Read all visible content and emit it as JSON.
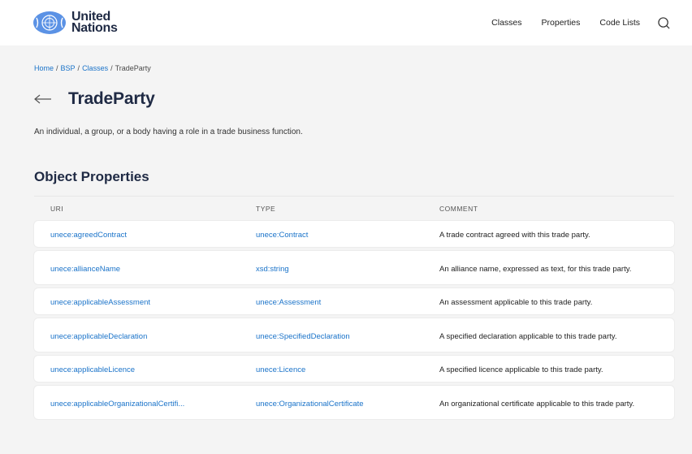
{
  "header": {
    "logo_line1": "United",
    "logo_line2": "Nations",
    "nav": [
      "Classes",
      "Properties",
      "Code Lists"
    ],
    "search_icon": "search-icon"
  },
  "breadcrumb": {
    "items": [
      "Home",
      "BSP",
      "Classes"
    ],
    "current": "TradeParty",
    "separator": "/"
  },
  "page": {
    "title": "TradeParty",
    "description": "An individual, a group, or a body having a role in a trade business function."
  },
  "object_properties": {
    "title": "Object Properties",
    "columns": [
      "URI",
      "TYPE",
      "COMMENT"
    ],
    "rows": [
      {
        "uri": "unece:agreedContract",
        "type": "unece:Contract",
        "comment": "A trade contract agreed with this trade party."
      },
      {
        "uri": "unece:allianceName",
        "type": "xsd:string",
        "comment": "An alliance name, expressed as text, for this trade party."
      },
      {
        "uri": "unece:applicableAssessment",
        "type": "unece:Assessment",
        "comment": "An assessment applicable to this trade party."
      },
      {
        "uri": "unece:applicableDeclaration",
        "type": "unece:SpecifiedDeclaration",
        "comment": "A specified declaration applicable to this trade party."
      },
      {
        "uri": "unece:applicableLicence",
        "type": "unece:Licence",
        "comment": "A specified licence applicable to this trade party."
      },
      {
        "uri": "unece:applicableOrganizationalCertifi...",
        "type": "unece:OrganizationalCertificate",
        "comment": "An organizational certificate applicable to this trade party."
      }
    ]
  },
  "colors": {
    "link": "#1a73c9",
    "heading": "#1f2a44",
    "background": "#f4f4f4",
    "emblem": "#5b92e5"
  }
}
